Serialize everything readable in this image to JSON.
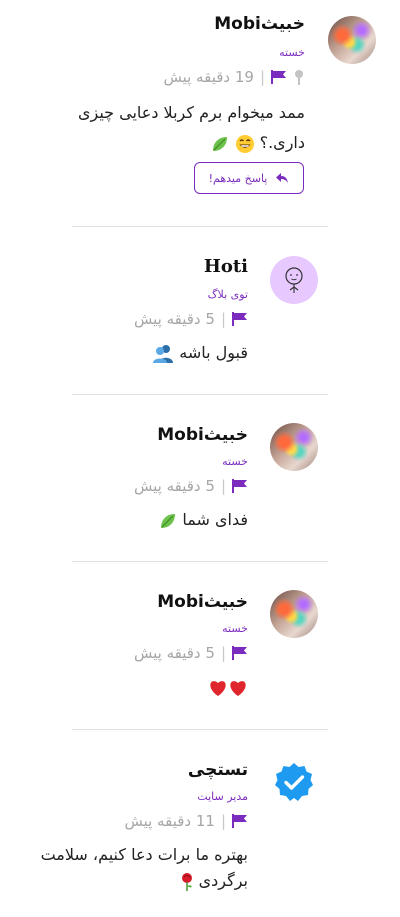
{
  "comments": [
    {
      "username": "خبیثMobi",
      "role": "خسته",
      "time": "19 دقیقه پیش",
      "body_line1": "ممد میخوام برم کربلا دعایی چیزی",
      "body_line2": "داری.؟",
      "emoji_names": [
        "grinning-face-icon",
        "leaf-icon"
      ],
      "pinned": true,
      "reply_label": "پاسخ میدهم!"
    },
    {
      "username": "Hoti",
      "role": "توی بلاگ",
      "time": "5 دقیقه پیش",
      "body": "قبول باشه",
      "emoji_names": [
        "people-icon"
      ]
    },
    {
      "username": "خبیثMobi",
      "role": "خسته",
      "time": "5 دقیقه پیش",
      "body": "فدای شما",
      "emoji_names": [
        "leaf-icon"
      ]
    },
    {
      "username": "خبیثMobi",
      "role": "خسته",
      "time": "5 دقیقه پیش",
      "body": "",
      "emoji_names": [
        "red-heart-icon",
        "red-heart-icon"
      ]
    },
    {
      "username": "تستچی",
      "role": "مدیر سایت",
      "time": "11 دقیقه پیش",
      "body_line1": "بهتره ما برات دعا کنیم، سلامت",
      "body_line2": "برگردی",
      "emoji_names": [
        "rose-icon"
      ],
      "verified": true
    }
  ],
  "colors": {
    "accent": "#7b2cbf",
    "verified": "#1e9bf0",
    "muted": "#a6a6a6",
    "heart": "#e0262d"
  }
}
